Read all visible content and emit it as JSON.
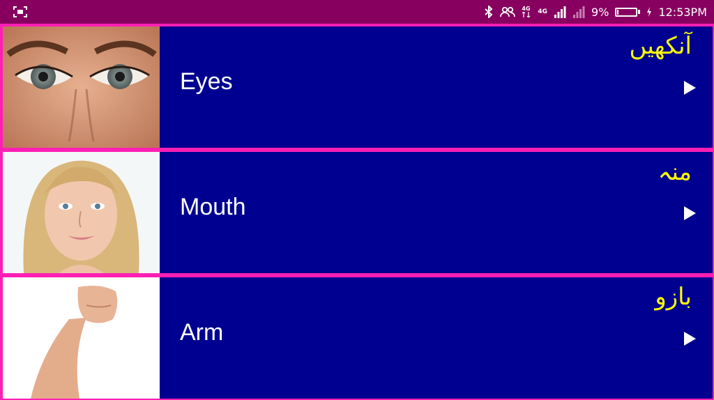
{
  "status_bar": {
    "network_label_1": "4G",
    "network_label_2": "4G",
    "battery_text": "9%",
    "battery_level": 0.09,
    "time": "12:53PM"
  },
  "items": [
    {
      "title": "Eyes",
      "urdu": "آنکھیں",
      "image": "eyes-photo"
    },
    {
      "title": "Mouth",
      "urdu": "منہ",
      "image": "face-photo"
    },
    {
      "title": "Arm",
      "urdu": "بازو",
      "image": "arm-photo"
    }
  ],
  "colors": {
    "status_bar_bg": "#870060",
    "row_bg": "#000090",
    "border": "#ff1fb4",
    "title": "#ffffff",
    "urdu": "#ffff00"
  }
}
